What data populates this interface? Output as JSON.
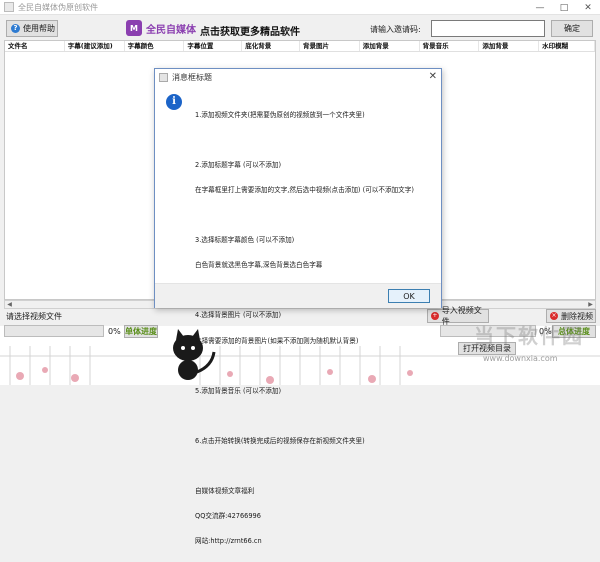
{
  "window": {
    "title": "全民自媒体伪原创软件",
    "minimize": "—",
    "maximize": "□",
    "close": "✕"
  },
  "toolbar": {
    "help_label": "使用帮助",
    "brand_logo_text": "M",
    "brand_name": "全民自媒体",
    "promo": "点击获取更多精品软件",
    "invite_label": "请输入邀请码:",
    "invite_value": "",
    "confirm_label": "确定"
  },
  "table": {
    "columns": [
      "文件名",
      "字幕(建议添加)",
      "字幕颜色",
      "字幕位置",
      "底化背景",
      "背景图片",
      "添加背景",
      "背景音乐",
      "添加背景",
      "水印模糊"
    ]
  },
  "bottom": {
    "file_label": "请选择视频文件",
    "import_label": "导入视频文件",
    "delete_label": "删除视频",
    "progress1_pct": "0%",
    "progress1_value": 0,
    "single_label": "单体进度",
    "progress2_pct": "0%",
    "progress2_value": 0,
    "overall_label": "总体进度",
    "open_dir_label": "打开视频目录"
  },
  "watermark": {
    "text": "当下软件园",
    "url": "www.downxia.com"
  },
  "dialog": {
    "title": "消息框标题",
    "lines": [
      "1.添加视频文件夹(把需要伪原创的视频放到一个文件夹里)",
      "",
      "2.添加标题字幕 (可以不添加)",
      "在字幕框里打上需要添加的文字,然后选中视频(点击添加) (可以不添加文字)",
      "",
      "3.选择标题字幕颜色 (可以不添加)",
      "白色背景就选黑色字幕,深色背景选白色字幕",
      "",
      "4.选择背景图片 (可以不添加)",
      "选择需要添加的背景图片(如果不添加则为随机默认背景)",
      "",
      "5.添加背景音乐 (可以不添加)",
      "",
      "6.点击开始转换(转换完成后的视频保存在新视频文件夹里)",
      "",
      "自媒体视频文章福利",
      "QQ交流群:42766996",
      "网站:http://zrnt66.cn"
    ],
    "ok_label": "OK"
  }
}
